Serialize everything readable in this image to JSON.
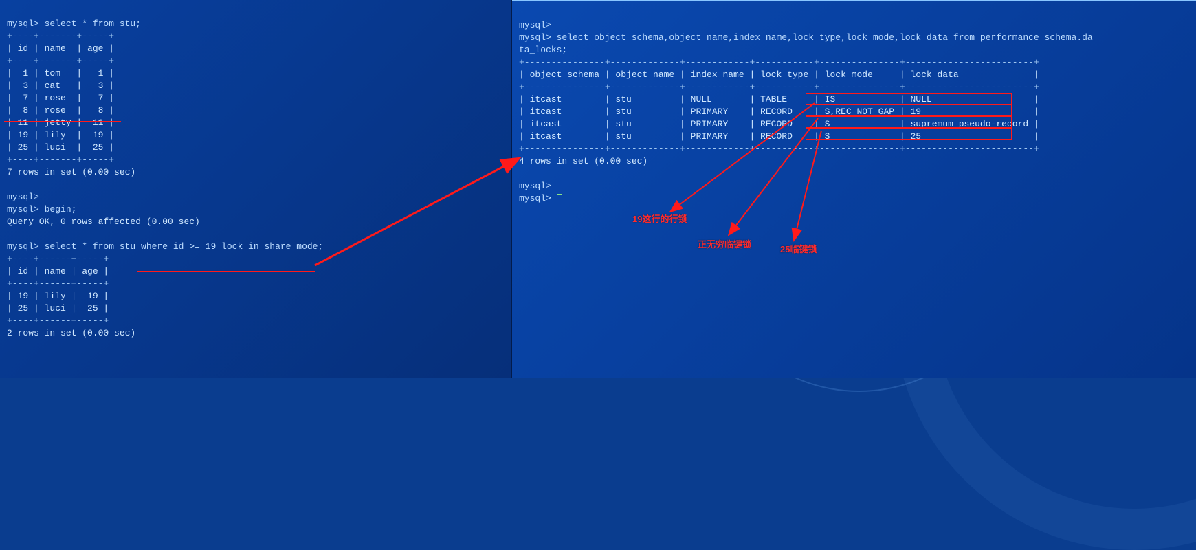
{
  "left": {
    "prompt1": "mysql> select * from stu;",
    "divider_top": "+----+-------+-----+",
    "header_row": "| id | name  | age |",
    "rows": [
      "|  1 | tom   |   1 |",
      "|  3 | cat   |   3 |",
      "|  7 | rose  |   7 |",
      "|  8 | rose  |   8 |",
      "| 11 | jetty |  11 |",
      "| 19 | lily  |  19 |",
      "| 25 | luci  |  25 |"
    ],
    "divider_bot": "+----+-------+-----+",
    "summary1": "7 rows in set (0.00 sec)",
    "prompt_blank": "mysql>",
    "prompt2": "mysql> begin;",
    "begin_result": "Query OK, 0 rows affected (0.00 sec)",
    "prompt3": "mysql> select * from stu where id >= 19 lock in share mode;",
    "divider2_top": "+----+------+-----+",
    "header2_row": "| id | name | age |",
    "divider2_mid": "+----+------+-----+",
    "rows2": [
      "| 19 | lily |  19 |",
      "| 25 | luci |  25 |"
    ],
    "divider2_bot": "+----+------+-----+",
    "summary2": "2 rows in set (0.00 sec)"
  },
  "right": {
    "prompt_blank": "mysql>",
    "prompt1": "mysql> select object_schema,object_name,index_name,lock_type,lock_mode,lock_data from performance_schema.da",
    "prompt1_cont": "ta_locks;",
    "divider_top": "+---------------+-------------+------------+-----------+---------------+------------------------+",
    "header_row": "| object_schema | object_name | index_name | lock_type | lock_mode     | lock_data              |",
    "divider_mid": "+---------------+-------------+------------+-----------+---------------+------------------------+",
    "rows": [
      "| itcast        | stu         | NULL       | TABLE     | IS            | NULL                   |",
      "| itcast        | stu         | PRIMARY    | RECORD    | S,REC_NOT_GAP | 19                     |",
      "| itcast        | stu         | PRIMARY    | RECORD    | S             | supremum pseudo-record |",
      "| itcast        | stu         | PRIMARY    | RECORD    | S             | 25                     |"
    ],
    "divider_bot": "+---------------+-------------+------------+-----------+---------------+------------------------+",
    "summary": "4 rows in set (0.00 sec)",
    "prompt2": "mysql>",
    "prompt3": "mysql> "
  },
  "annotations": {
    "note1": "19这行的行锁",
    "note2": "正无穷临键锁",
    "note3": "25临键锁"
  }
}
